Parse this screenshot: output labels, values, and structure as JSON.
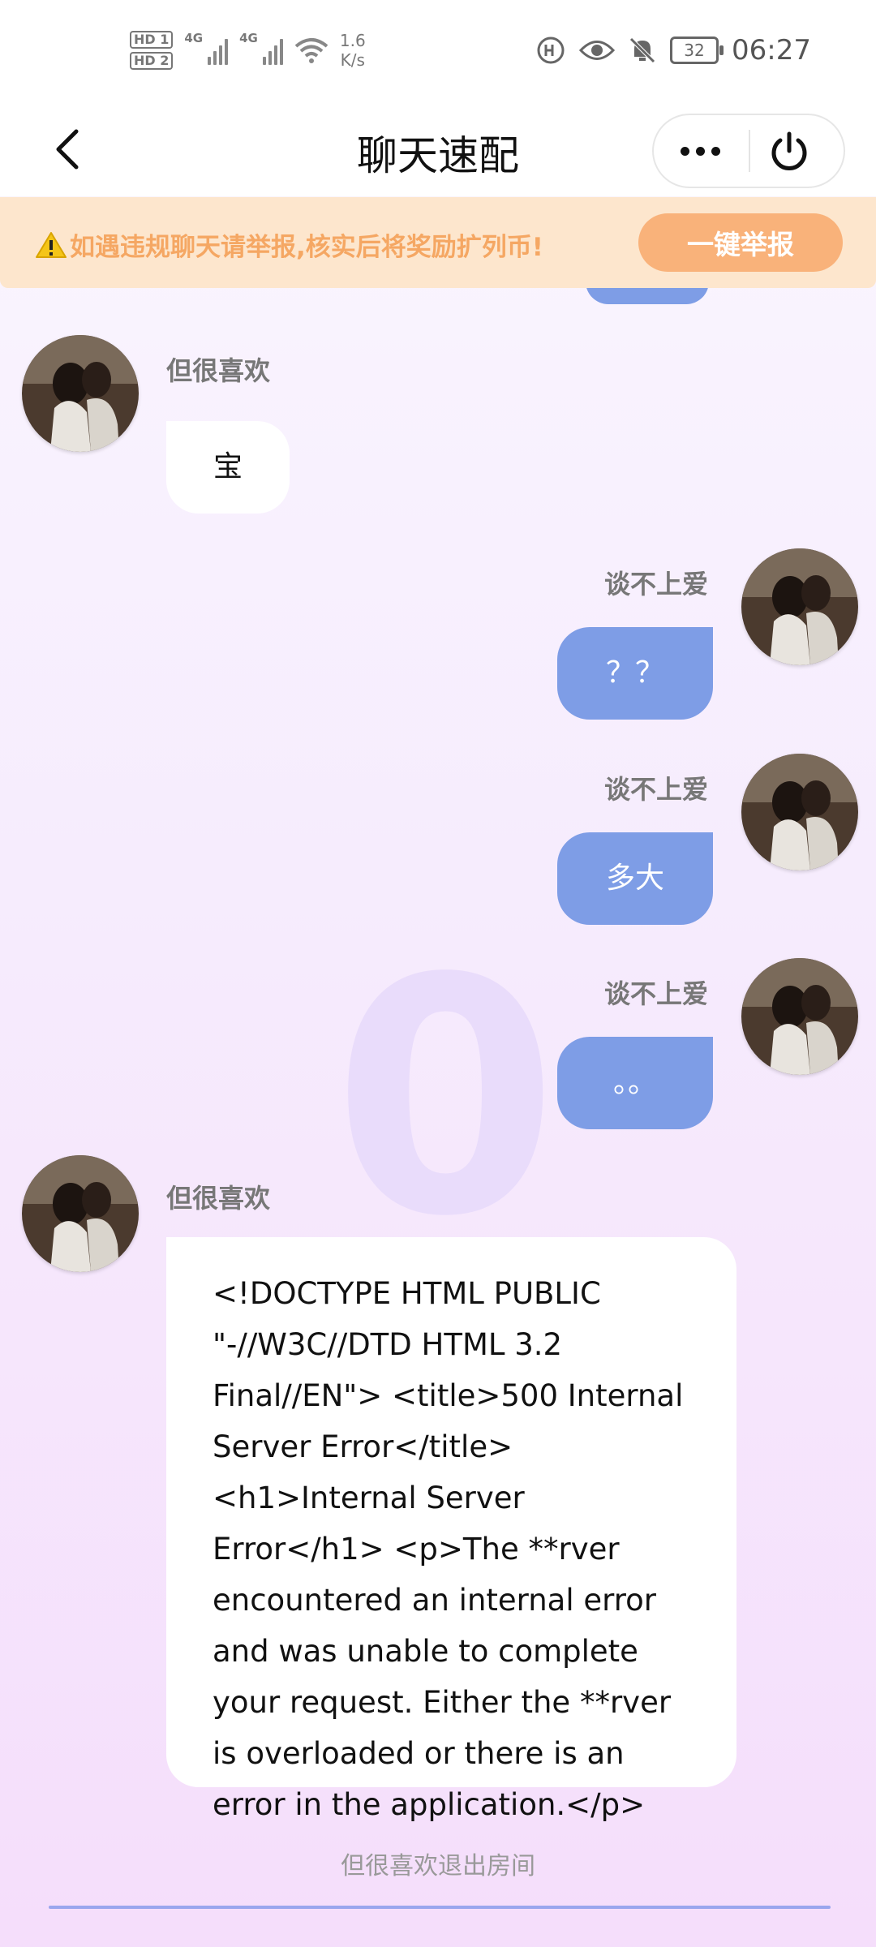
{
  "status_bar": {
    "sim1": "HD 1",
    "sim2": "HD 2",
    "net1": "4G",
    "net2": "4G",
    "speed_value": "1.6",
    "speed_unit": "K/s",
    "battery": "32",
    "time": "06:27"
  },
  "header": {
    "title": "聊天速配",
    "more_icon": "more-dots-icon",
    "power_icon": "power-icon"
  },
  "notice": {
    "text": "如遇违规聊天请举报,核实后将奖励扩列币!",
    "button": "一键举报",
    "color": "#f5a763"
  },
  "colors": {
    "outgoing_bubble": "#7e9de6",
    "incoming_bubble": "#ffffff",
    "banner_bg": "#fde6cd",
    "report_button": "#f9b27a"
  },
  "watermark": "0",
  "messages": [
    {
      "side": "in",
      "name": "但很喜欢",
      "text": "宝"
    },
    {
      "side": "out",
      "name": "谈不上爱",
      "text": "？？"
    },
    {
      "side": "out",
      "name": "谈不上爱",
      "text": "多大"
    },
    {
      "side": "out",
      "name": "谈不上爱",
      "text": "。。"
    },
    {
      "side": "in",
      "name": "但很喜欢",
      "text": "<!DOCTYPE HTML PUBLIC \"-//W3C//DTD HTML 3.2 Final//EN\"> <title>500 Internal Server Error</title> <h1>Internal Server Error</h1> <p>The **rver encountered an internal error and was unable to complete your request. Either the **rver is overloaded or there is an error in the application.</p>"
    }
  ],
  "system_message": "但很喜欢退出房间"
}
